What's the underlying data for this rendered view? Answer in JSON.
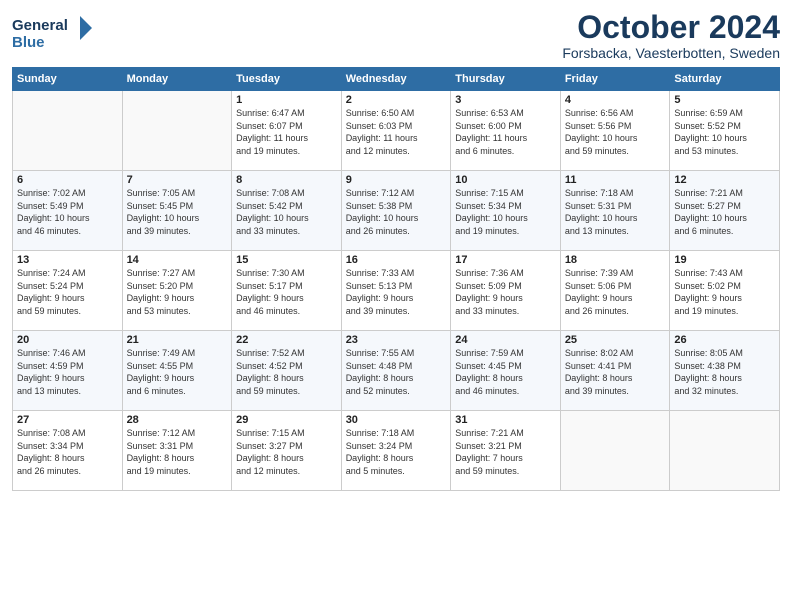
{
  "logo": {
    "line1": "General",
    "line2": "Blue"
  },
  "title": "October 2024",
  "location": "Forsbacka, Vaesterbotten, Sweden",
  "days_header": [
    "Sunday",
    "Monday",
    "Tuesday",
    "Wednesday",
    "Thursday",
    "Friday",
    "Saturday"
  ],
  "weeks": [
    [
      {
        "day": "",
        "info": ""
      },
      {
        "day": "",
        "info": ""
      },
      {
        "day": "1",
        "info": "Sunrise: 6:47 AM\nSunset: 6:07 PM\nDaylight: 11 hours\nand 19 minutes."
      },
      {
        "day": "2",
        "info": "Sunrise: 6:50 AM\nSunset: 6:03 PM\nDaylight: 11 hours\nand 12 minutes."
      },
      {
        "day": "3",
        "info": "Sunrise: 6:53 AM\nSunset: 6:00 PM\nDaylight: 11 hours\nand 6 minutes."
      },
      {
        "day": "4",
        "info": "Sunrise: 6:56 AM\nSunset: 5:56 PM\nDaylight: 10 hours\nand 59 minutes."
      },
      {
        "day": "5",
        "info": "Sunrise: 6:59 AM\nSunset: 5:52 PM\nDaylight: 10 hours\nand 53 minutes."
      }
    ],
    [
      {
        "day": "6",
        "info": "Sunrise: 7:02 AM\nSunset: 5:49 PM\nDaylight: 10 hours\nand 46 minutes."
      },
      {
        "day": "7",
        "info": "Sunrise: 7:05 AM\nSunset: 5:45 PM\nDaylight: 10 hours\nand 39 minutes."
      },
      {
        "day": "8",
        "info": "Sunrise: 7:08 AM\nSunset: 5:42 PM\nDaylight: 10 hours\nand 33 minutes."
      },
      {
        "day": "9",
        "info": "Sunrise: 7:12 AM\nSunset: 5:38 PM\nDaylight: 10 hours\nand 26 minutes."
      },
      {
        "day": "10",
        "info": "Sunrise: 7:15 AM\nSunset: 5:34 PM\nDaylight: 10 hours\nand 19 minutes."
      },
      {
        "day": "11",
        "info": "Sunrise: 7:18 AM\nSunset: 5:31 PM\nDaylight: 10 hours\nand 13 minutes."
      },
      {
        "day": "12",
        "info": "Sunrise: 7:21 AM\nSunset: 5:27 PM\nDaylight: 10 hours\nand 6 minutes."
      }
    ],
    [
      {
        "day": "13",
        "info": "Sunrise: 7:24 AM\nSunset: 5:24 PM\nDaylight: 9 hours\nand 59 minutes."
      },
      {
        "day": "14",
        "info": "Sunrise: 7:27 AM\nSunset: 5:20 PM\nDaylight: 9 hours\nand 53 minutes."
      },
      {
        "day": "15",
        "info": "Sunrise: 7:30 AM\nSunset: 5:17 PM\nDaylight: 9 hours\nand 46 minutes."
      },
      {
        "day": "16",
        "info": "Sunrise: 7:33 AM\nSunset: 5:13 PM\nDaylight: 9 hours\nand 39 minutes."
      },
      {
        "day": "17",
        "info": "Sunrise: 7:36 AM\nSunset: 5:09 PM\nDaylight: 9 hours\nand 33 minutes."
      },
      {
        "day": "18",
        "info": "Sunrise: 7:39 AM\nSunset: 5:06 PM\nDaylight: 9 hours\nand 26 minutes."
      },
      {
        "day": "19",
        "info": "Sunrise: 7:43 AM\nSunset: 5:02 PM\nDaylight: 9 hours\nand 19 minutes."
      }
    ],
    [
      {
        "day": "20",
        "info": "Sunrise: 7:46 AM\nSunset: 4:59 PM\nDaylight: 9 hours\nand 13 minutes."
      },
      {
        "day": "21",
        "info": "Sunrise: 7:49 AM\nSunset: 4:55 PM\nDaylight: 9 hours\nand 6 minutes."
      },
      {
        "day": "22",
        "info": "Sunrise: 7:52 AM\nSunset: 4:52 PM\nDaylight: 8 hours\nand 59 minutes."
      },
      {
        "day": "23",
        "info": "Sunrise: 7:55 AM\nSunset: 4:48 PM\nDaylight: 8 hours\nand 52 minutes."
      },
      {
        "day": "24",
        "info": "Sunrise: 7:59 AM\nSunset: 4:45 PM\nDaylight: 8 hours\nand 46 minutes."
      },
      {
        "day": "25",
        "info": "Sunrise: 8:02 AM\nSunset: 4:41 PM\nDaylight: 8 hours\nand 39 minutes."
      },
      {
        "day": "26",
        "info": "Sunrise: 8:05 AM\nSunset: 4:38 PM\nDaylight: 8 hours\nand 32 minutes."
      }
    ],
    [
      {
        "day": "27",
        "info": "Sunrise: 7:08 AM\nSunset: 3:34 PM\nDaylight: 8 hours\nand 26 minutes."
      },
      {
        "day": "28",
        "info": "Sunrise: 7:12 AM\nSunset: 3:31 PM\nDaylight: 8 hours\nand 19 minutes."
      },
      {
        "day": "29",
        "info": "Sunrise: 7:15 AM\nSunset: 3:27 PM\nDaylight: 8 hours\nand 12 minutes."
      },
      {
        "day": "30",
        "info": "Sunrise: 7:18 AM\nSunset: 3:24 PM\nDaylight: 8 hours\nand 5 minutes."
      },
      {
        "day": "31",
        "info": "Sunrise: 7:21 AM\nSunset: 3:21 PM\nDaylight: 7 hours\nand 59 minutes."
      },
      {
        "day": "",
        "info": ""
      },
      {
        "day": "",
        "info": ""
      }
    ]
  ]
}
